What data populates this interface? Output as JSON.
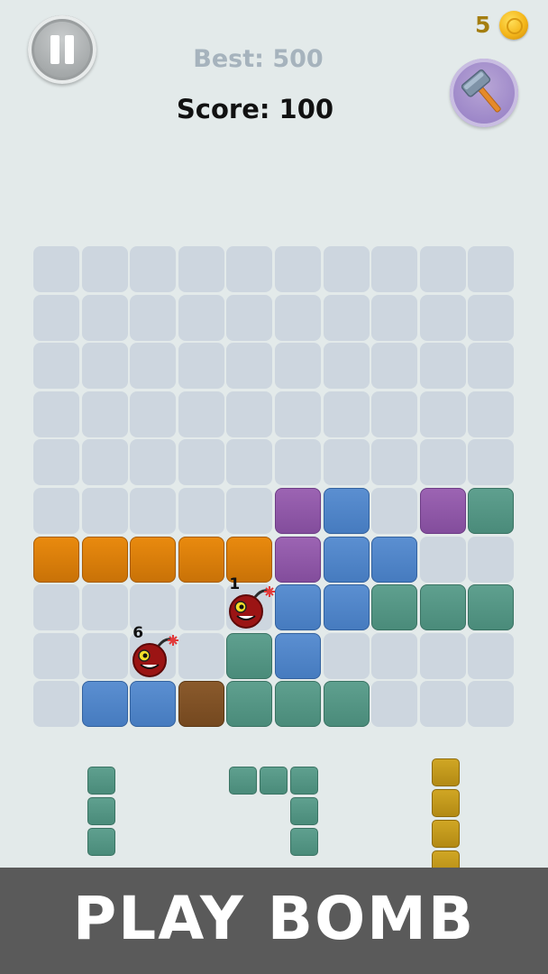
{
  "hud": {
    "best_label": "Best: 500",
    "score_label": "Score: 100",
    "coins": "5",
    "pause_icon": "pause-icon",
    "hammer_icon": "hammer-icon",
    "coin_icon": "coin-icon"
  },
  "board": {
    "rows": 10,
    "cols": 10,
    "filled": [
      {
        "row": 5,
        "col": 5,
        "color": "purple"
      },
      {
        "row": 5,
        "col": 6,
        "color": "blue"
      },
      {
        "row": 5,
        "col": 8,
        "color": "purple"
      },
      {
        "row": 5,
        "col": 9,
        "color": "teal"
      },
      {
        "row": 6,
        "col": 0,
        "color": "orange"
      },
      {
        "row": 6,
        "col": 1,
        "color": "orange"
      },
      {
        "row": 6,
        "col": 2,
        "color": "orange"
      },
      {
        "row": 6,
        "col": 3,
        "color": "orange"
      },
      {
        "row": 6,
        "col": 4,
        "color": "orange"
      },
      {
        "row": 6,
        "col": 5,
        "color": "purple"
      },
      {
        "row": 6,
        "col": 6,
        "color": "blue"
      },
      {
        "row": 6,
        "col": 7,
        "color": "blue"
      },
      {
        "row": 7,
        "col": 5,
        "color": "blue"
      },
      {
        "row": 7,
        "col": 6,
        "color": "blue"
      },
      {
        "row": 7,
        "col": 7,
        "color": "teal"
      },
      {
        "row": 7,
        "col": 8,
        "color": "teal"
      },
      {
        "row": 7,
        "col": 9,
        "color": "teal"
      },
      {
        "row": 8,
        "col": 4,
        "color": "teal"
      },
      {
        "row": 8,
        "col": 5,
        "color": "blue"
      },
      {
        "row": 9,
        "col": 1,
        "color": "blue"
      },
      {
        "row": 9,
        "col": 2,
        "color": "blue"
      },
      {
        "row": 9,
        "col": 3,
        "color": "brown"
      },
      {
        "row": 9,
        "col": 4,
        "color": "teal"
      },
      {
        "row": 9,
        "col": 5,
        "color": "teal"
      },
      {
        "row": 9,
        "col": 6,
        "color": "teal"
      }
    ],
    "bombs": [
      {
        "row": 7,
        "col": 4,
        "count": "1"
      },
      {
        "row": 8,
        "col": 2,
        "count": "6"
      }
    ]
  },
  "pieces": [
    {
      "name": "piece-vertical-3-teal",
      "color": "teal",
      "cells": [
        [
          0,
          0
        ],
        [
          1,
          0
        ],
        [
          2,
          0
        ]
      ]
    },
    {
      "name": "piece-corner-teal",
      "color": "teal",
      "cells": [
        [
          0,
          0
        ],
        [
          0,
          1
        ],
        [
          0,
          2
        ],
        [
          1,
          2
        ],
        [
          2,
          2
        ]
      ]
    },
    {
      "name": "piece-vertical-4-gold",
      "color": "gold",
      "cells": [
        [
          0,
          0
        ],
        [
          1,
          0
        ],
        [
          2,
          0
        ],
        [
          3,
          0
        ]
      ]
    }
  ],
  "colors": {
    "orange": "#e2840c",
    "purple": "#9159a9",
    "blue": "#5088cc",
    "teal": "#559684",
    "brown": "#805027",
    "gold": "#c59a1c",
    "empty": "#cdd6df",
    "background": "#e3eaea"
  },
  "banner": {
    "text": "PLAY BOMB"
  }
}
